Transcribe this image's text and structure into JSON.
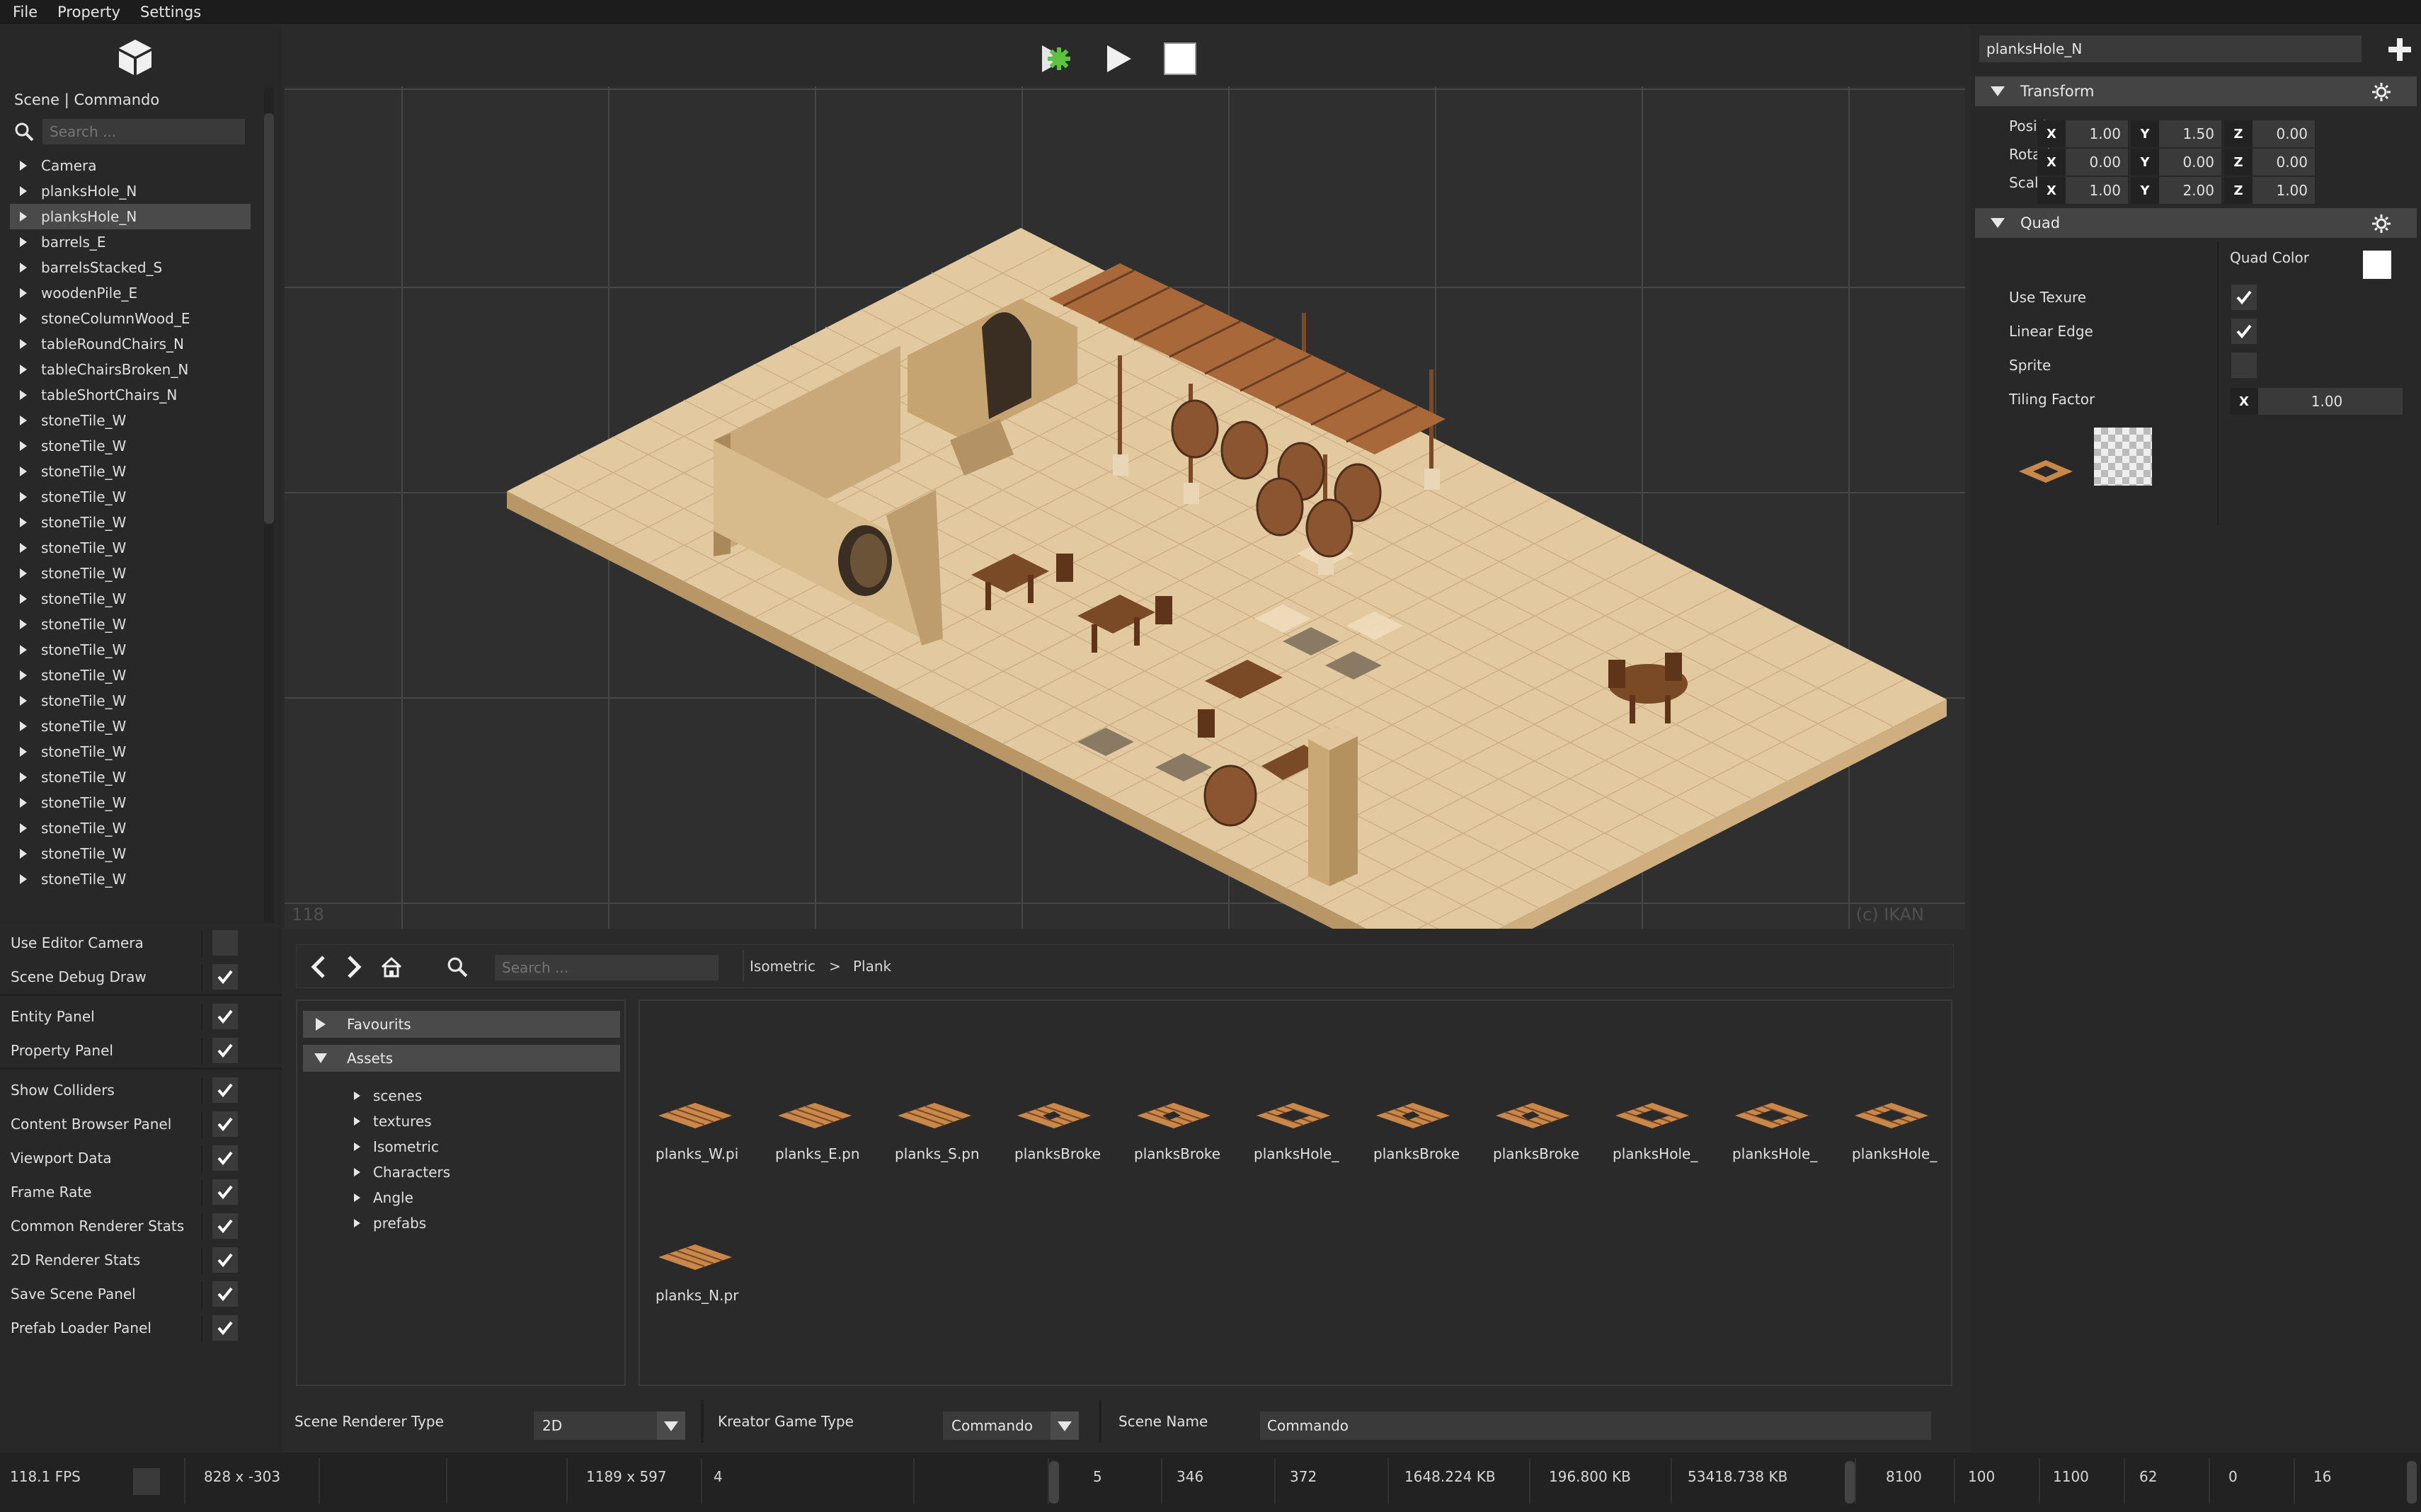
{
  "menu": [
    "File",
    "Property",
    "Settings"
  ],
  "scene": {
    "header": "Scene | Commando",
    "search_placeholder": "Search ...",
    "items": [
      "Camera",
      "planksHole_N",
      "planksHole_N",
      "barrels_E",
      "barrelsStacked_S",
      "woodenPile_E",
      "stoneColumnWood_E",
      "tableRoundChairs_N",
      "tableChairsBroken_N",
      "tableShortChairs_N",
      "stoneTile_W",
      "stoneTile_W",
      "stoneTile_W",
      "stoneTile_W",
      "stoneTile_W",
      "stoneTile_W",
      "stoneTile_W",
      "stoneTile_W",
      "stoneTile_W",
      "stoneTile_W",
      "stoneTile_W",
      "stoneTile_W",
      "stoneTile_W",
      "stoneTile_W",
      "stoneTile_W",
      "stoneTile_W",
      "stoneTile_W",
      "stoneTile_W",
      "stoneTile_W"
    ],
    "selected_index": 2
  },
  "settings": [
    {
      "label": "Use Editor Camera",
      "checked": false
    },
    {
      "label": "Scene Debug Draw",
      "checked": true
    },
    {
      "label": "Entity Panel",
      "checked": true
    },
    {
      "label": "Property Panel",
      "checked": true
    },
    {
      "label": "Show Colliders",
      "checked": true
    },
    {
      "label": "Content Browser Panel",
      "checked": true
    },
    {
      "label": "Viewport Data",
      "checked": true
    },
    {
      "label": "Frame Rate",
      "checked": true
    },
    {
      "label": "Common Renderer Stats",
      "checked": true
    },
    {
      "label": "2D Renderer Stats",
      "checked": true
    },
    {
      "label": "Save Scene Panel",
      "checked": true
    },
    {
      "label": "Prefab Loader Panel",
      "checked": true
    }
  ],
  "viewport": {
    "fps_overlay": "118",
    "copyright": "(c) IKAN"
  },
  "content_browser": {
    "search_placeholder": "Search ...",
    "breadcrumb": [
      "Isometric",
      ">",
      "Plank"
    ],
    "favourites": "Favourits",
    "assets": "Assets",
    "folders": [
      "scenes",
      "textures",
      "Isometric",
      "Characters",
      "Angle",
      "prefabs"
    ],
    "files": [
      "planks_W.pi",
      "planks_E.pn",
      "planks_S.pn",
      "planksBroke",
      "planksBroke",
      "planksHole_",
      "planksBroke",
      "planksBroke",
      "planksHole_",
      "planksHole_",
      "planksHole_",
      "planks_N.pr"
    ]
  },
  "config": {
    "renderer_label": "Scene Renderer Type",
    "renderer_value": "2D",
    "game_label": "Kreator Game Type",
    "game_value": "Commando",
    "scene_name_label": "Scene Name",
    "scene_name_value": "Commando"
  },
  "properties": {
    "entity_name": "planksHole_N",
    "transform_title": "Transform",
    "position_label": "Position",
    "rotation_label": "Rotation",
    "scale_label": "Scale",
    "position": [
      "1.00",
      "1.50",
      "0.00"
    ],
    "rotation": [
      "0.00",
      "0.00",
      "0.00"
    ],
    "scale": [
      "1.00",
      "2.00",
      "1.00"
    ],
    "axes": [
      "X",
      "Y",
      "Z"
    ],
    "quad_title": "Quad",
    "quad_color_label": "Quad Color",
    "use_texture_label": "Use Texure",
    "use_texture": true,
    "linear_edge_label": "Linear Edge",
    "linear_edge": true,
    "sprite_label": "Sprite",
    "sprite": false,
    "tiling_label": "Tiling Factor",
    "tiling_axis": "X",
    "tiling_value": "1.00"
  },
  "status": [
    "118.1 FPS",
    "828 x -303",
    "1189 x 597",
    "4",
    "5",
    "346",
    "372",
    "1648.224 KB",
    "196.800 KB",
    "53418.738 KB",
    "8100",
    "100",
    "1100",
    "62",
    "0",
    "16"
  ],
  "colors": {
    "accent_green": "#5cc241",
    "wood": "#c9874a",
    "tile": "#e2c9a3",
    "panel": "#282828"
  }
}
